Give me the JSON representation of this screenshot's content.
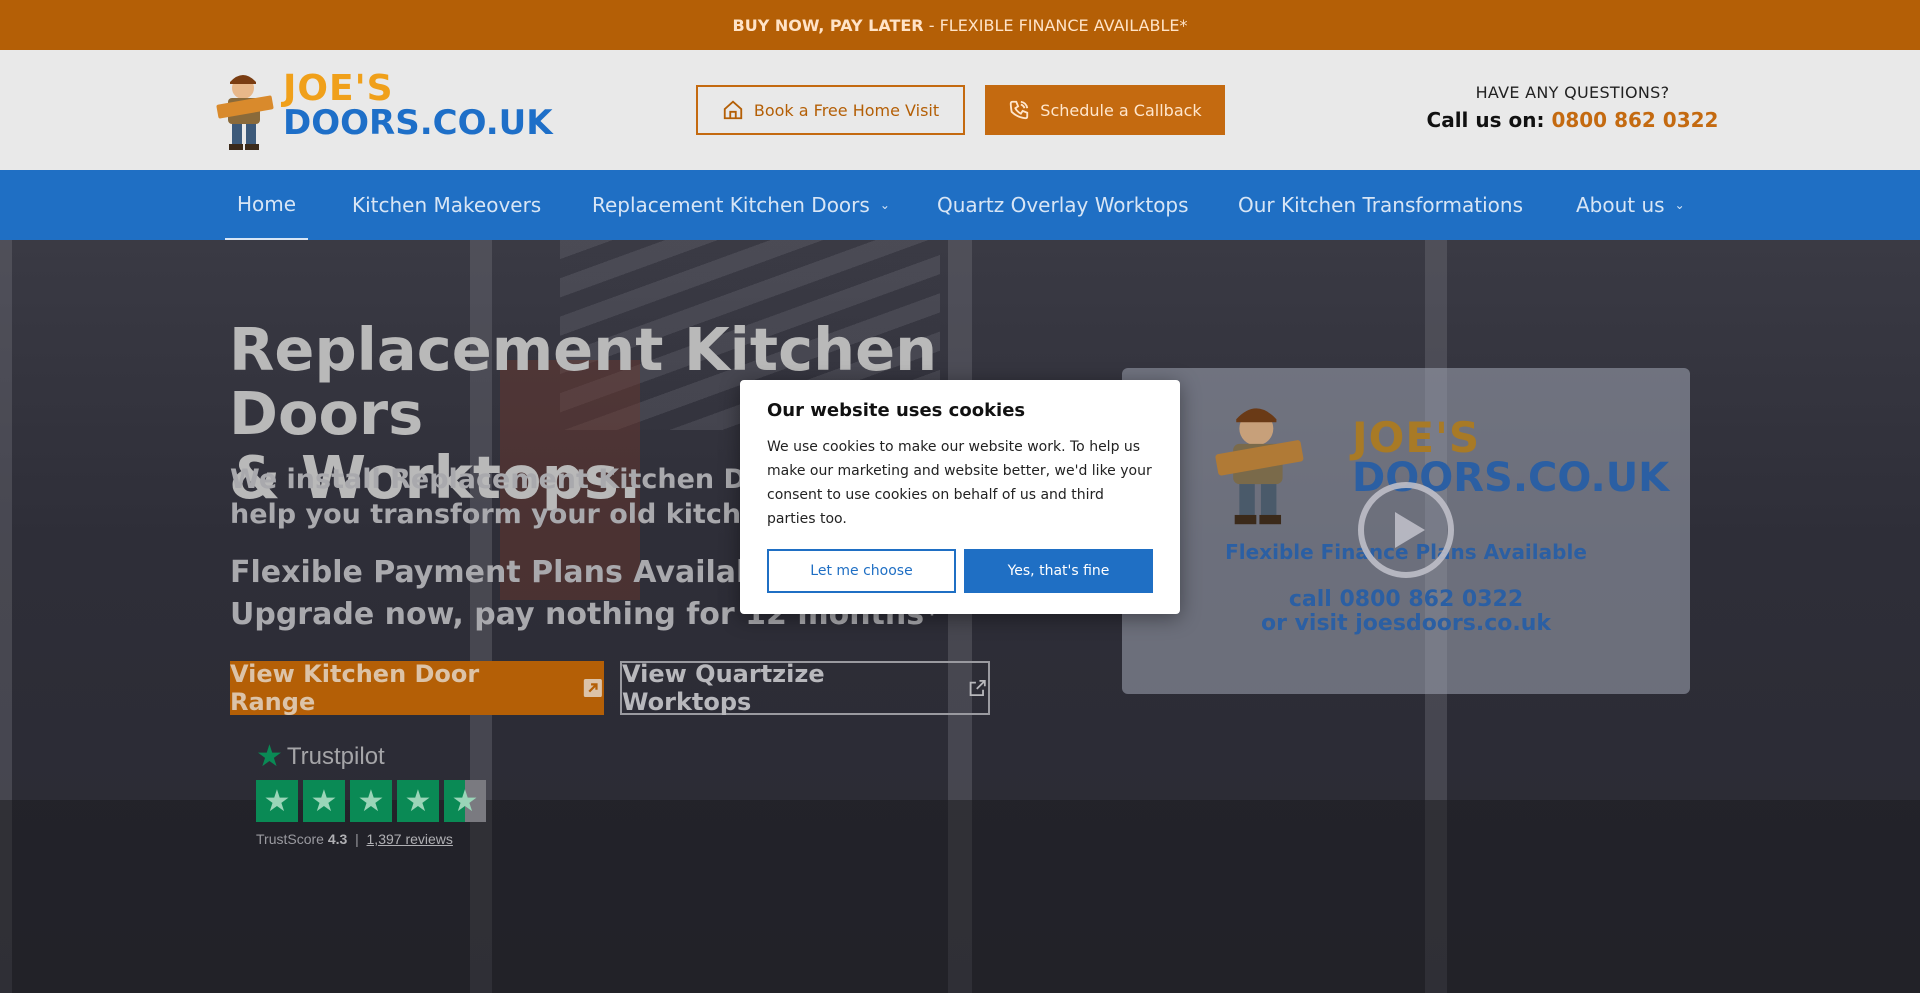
{
  "promo": {
    "bold": "BUY NOW, PAY LATER",
    "rest": " - FLEXIBLE FINANCE AVAILABLE*"
  },
  "header": {
    "logo_line1": "JOE'S",
    "logo_line2": "DOORS.CO.UK",
    "visit_button": "Book a Free Home Visit",
    "callback_button": "Schedule a Callback",
    "questions_label": "HAVE ANY QUESTIONS?",
    "call_label": "Call us on: ",
    "phone": "0800 862 0322"
  },
  "nav": {
    "items": [
      {
        "label": "Home"
      },
      {
        "label": "Kitchen Makeovers"
      },
      {
        "label": "Replacement Kitchen Doors"
      },
      {
        "label": "Quartz Overlay Worktops"
      },
      {
        "label": "Our Kitchen Transformations"
      },
      {
        "label": "About us"
      }
    ]
  },
  "hero": {
    "title_line1": "Replacement Kitchen Doors",
    "title_line2": "& Worktops.",
    "sub_line1": "We install Replacement Kitchen Doors",
    "sub_line2": "help you transform your old kitchen - a",
    "payment_line1": "Flexible Payment Plans Available",
    "payment_line2": "Upgrade now, pay nothing for 12 months*",
    "cta_primary": "View Kitchen Door Range",
    "cta_secondary": "View Quartzize Worktops"
  },
  "trustpilot": {
    "brand": "Trustpilot",
    "score_label": "TrustScore",
    "score": "4.3",
    "separator": "|",
    "reviews": "1,397 reviews",
    "rating_stars": 4.5
  },
  "video": {
    "logo_line1": "JOE'S",
    "logo_line2": "DOORS.CO.UK",
    "subtitle": "Flexible Finance Plans Available",
    "call_line1": "call 0800 862 0322",
    "call_line2": "or visit joesdoors.co.uk"
  },
  "cookie": {
    "title": "Our website uses cookies",
    "body": "We use cookies to make our website work. To help us make our marketing and website better, we'd like your consent to use cookies on behalf of us and third parties too.",
    "choose_button": "Let me choose",
    "accept_button": "Yes, that's fine"
  },
  "colors": {
    "orange": "#b45f06",
    "blue": "#1f6fc4",
    "trustpilot_green": "#0a8a55"
  }
}
